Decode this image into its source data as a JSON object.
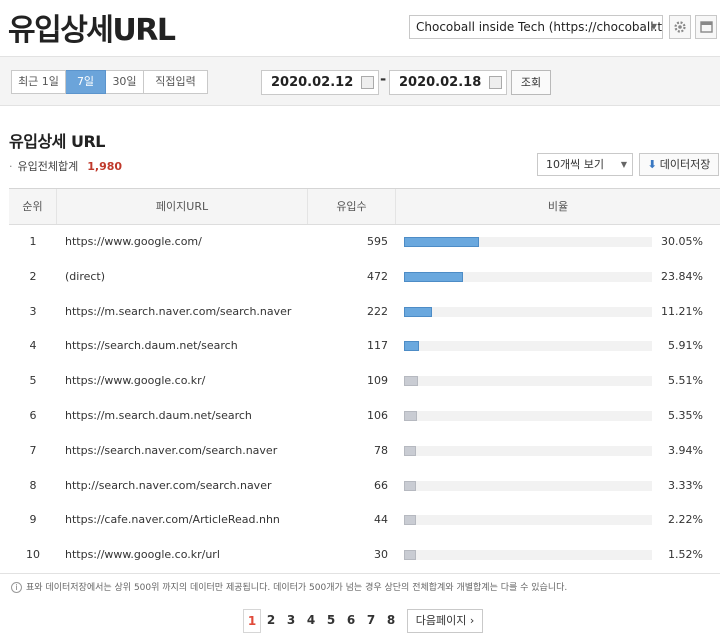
{
  "header": {
    "title": "유입상세URL",
    "site_select": "Chocoball inside Tech (https://chocoball.t···",
    "settings_icon": "gear-icon",
    "window_icon": "window-icon"
  },
  "period_tabs": [
    "최근 1일",
    "7일",
    "30일",
    "직접입력"
  ],
  "active_tab": "7일",
  "dates": {
    "start": "2020.02.12",
    "end": "2020.02.18",
    "separator": "-"
  },
  "query_button": "조회",
  "section": {
    "title": "유입상세 URL",
    "total_label": "유입전체합계",
    "total_value": "1,980",
    "per_page": "10개씩 보기",
    "download_label": "데이터저장"
  },
  "table": {
    "columns": [
      "순위",
      "페이지URL",
      "유입수",
      "비율"
    ],
    "rows": [
      {
        "rank": "1",
        "url": "https://www.google.com/",
        "count": "595",
        "ratio": "30.05%",
        "value": 30.05,
        "hi": true
      },
      {
        "rank": "2",
        "url": "(direct)",
        "count": "472",
        "ratio": "23.84%",
        "value": 23.84,
        "hi": true
      },
      {
        "rank": "3",
        "url": "https://m.search.naver.com/search.naver",
        "count": "222",
        "ratio": "11.21%",
        "value": 11.21,
        "hi": true
      },
      {
        "rank": "4",
        "url": "https://search.daum.net/search",
        "count": "117",
        "ratio": "5.91%",
        "value": 5.91,
        "hi": true
      },
      {
        "rank": "5",
        "url": "https://www.google.co.kr/",
        "count": "109",
        "ratio": "5.51%",
        "value": 5.51,
        "hi": false
      },
      {
        "rank": "6",
        "url": "https://m.search.daum.net/search",
        "count": "106",
        "ratio": "5.35%",
        "value": 5.35,
        "hi": false
      },
      {
        "rank": "7",
        "url": "https://search.naver.com/search.naver",
        "count": "78",
        "ratio": "3.94%",
        "value": 3.94,
        "hi": false
      },
      {
        "rank": "8",
        "url": "http://search.naver.com/search.naver",
        "count": "66",
        "ratio": "3.33%",
        "value": 3.33,
        "hi": false
      },
      {
        "rank": "9",
        "url": "https://cafe.naver.com/ArticleRead.nhn",
        "count": "44",
        "ratio": "2.22%",
        "value": 2.22,
        "hi": false
      },
      {
        "rank": "10",
        "url": "https://www.google.co.kr/url",
        "count": "30",
        "ratio": "1.52%",
        "value": 1.52,
        "hi": false
      }
    ]
  },
  "notice": "표와 데이터저장에서는 상위 500위 까지의 데이터만 제공됩니다. 데이터가 500개가 넘는 경우 상단의 전체합계와 개별합계는 다를 수 있습니다.",
  "pager": {
    "pages": [
      "1",
      "2",
      "3",
      "4",
      "5",
      "6",
      "7",
      "8"
    ],
    "current": "1",
    "next_label": "다음페이지 ›"
  }
}
